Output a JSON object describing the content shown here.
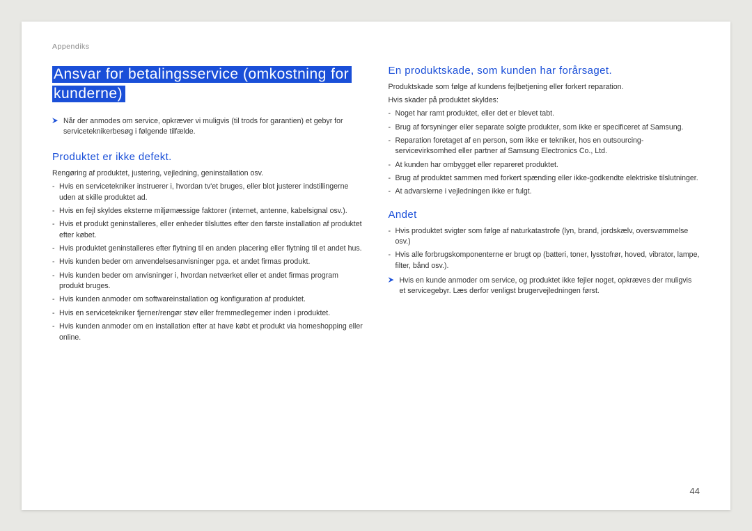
{
  "header": "Appendiks",
  "pageNumber": "44",
  "left": {
    "title": "Ansvar for betalingsservice (omkostning for kunderne)",
    "intro": "Når der anmodes om service, opkræver vi muligvis (til trods for garantien) et gebyr for serviceteknikerbesøg i følgende tilfælde.",
    "section1": {
      "heading": "Produktet er ikke defekt.",
      "lead": "Rengøring af produktet, justering, vejledning, geninstallation osv.",
      "items": [
        "Hvis en servicetekniker instruerer i, hvordan tv'et bruges, eller blot justerer indstillingerne uden at skille produktet ad.",
        "Hvis en fejl skyldes eksterne miljømæssige faktorer (internet, antenne, kabelsignal osv.).",
        "Hvis et produkt geninstalleres, eller enheder tilsluttes efter den første installation af produktet efter købet.",
        "Hvis produktet geninstalleres efter flytning til en anden placering eller flytning til et andet hus.",
        "Hvis kunden beder om anvendelsesanvisninger pga. et andet firmas produkt.",
        "Hvis kunden beder om anvisninger i, hvordan netværket eller et andet firmas program produkt bruges.",
        "Hvis kunden anmoder om softwareinstallation og konfiguration af produktet.",
        "Hvis en servicetekniker fjerner/rengør støv eller fremmedlegemer inden i produktet.",
        "Hvis kunden anmoder om en installation efter at have købt et produkt via homeshopping eller online."
      ]
    }
  },
  "right": {
    "section2": {
      "heading": "En produktskade, som kunden har forårsaget.",
      "lead1": "Produktskade som følge af kundens fejlbetjening eller forkert reparation.",
      "lead2": "Hvis skader på produktet skyldes:",
      "items": [
        "Noget har ramt produktet, eller det er blevet tabt.",
        "Brug af forsyninger eller separate solgte produkter, som ikke er specificeret af Samsung.",
        "Reparation foretaget af en person, som ikke er tekniker, hos en outsourcing-servicevirksomhed eller partner af Samsung Electronics Co., Ltd.",
        "At kunden har ombygget eller repareret produktet.",
        "Brug af produktet sammen med forkert spænding eller ikke-godkendte elektriske tilslutninger.",
        "At advarslerne i vejledningen ikke er fulgt."
      ]
    },
    "section3": {
      "heading": "Andet",
      "items": [
        "Hvis produktet svigter som følge af naturkatastrofe (lyn, brand, jordskælv, oversvømmelse osv.)",
        "Hvis alle forbrugskomponenterne er brugt op (batteri, toner, lysstofrør, hoved, vibrator, lampe, filter, bånd osv.)."
      ],
      "note": "Hvis en kunde anmoder om service, og produktet ikke fejler noget, opkræves der muligvis et servicegebyr. Læs derfor venligst brugervejledningen først."
    }
  }
}
